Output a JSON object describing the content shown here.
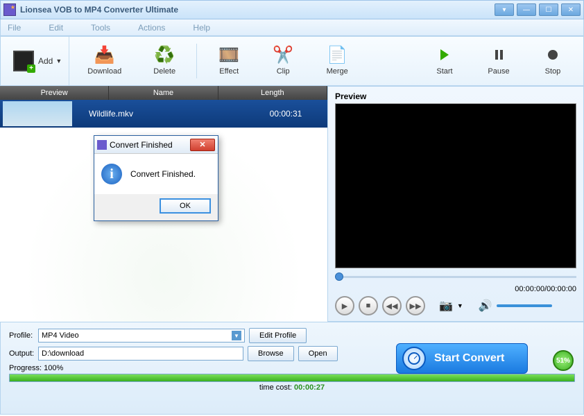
{
  "window": {
    "title": "Lionsea VOB to MP4 Converter Ultimate"
  },
  "menu": {
    "file": "File",
    "edit": "Edit",
    "tools": "Tools",
    "actions": "Actions",
    "help": "Help"
  },
  "toolbar": {
    "add": "Add",
    "download": "Download",
    "delete": "Delete",
    "effect": "Effect",
    "clip": "Clip",
    "merge": "Merge",
    "start": "Start",
    "pause": "Pause",
    "stop": "Stop"
  },
  "list": {
    "headers": {
      "preview": "Preview",
      "name": "Name",
      "length": "Length"
    },
    "row": {
      "name": "Wildlife.mkv",
      "length": "00:00:31"
    }
  },
  "preview": {
    "label": "Preview",
    "time": "00:00:00/00:00:00"
  },
  "form": {
    "profile_label": "Profile:",
    "profile_value": "MP4 Video",
    "edit_profile": "Edit Profile",
    "output_label": "Output:",
    "output_value": "D:\\download",
    "browse": "Browse",
    "open": "Open",
    "progress_label": "Progress: 100%",
    "time_cost_label": "time cost:",
    "time_cost_value": "00:00:27"
  },
  "convert": {
    "button": "Start Convert",
    "badge": "51%"
  },
  "dialog": {
    "title": "Convert Finished",
    "message": "Convert Finished.",
    "ok": "OK"
  }
}
